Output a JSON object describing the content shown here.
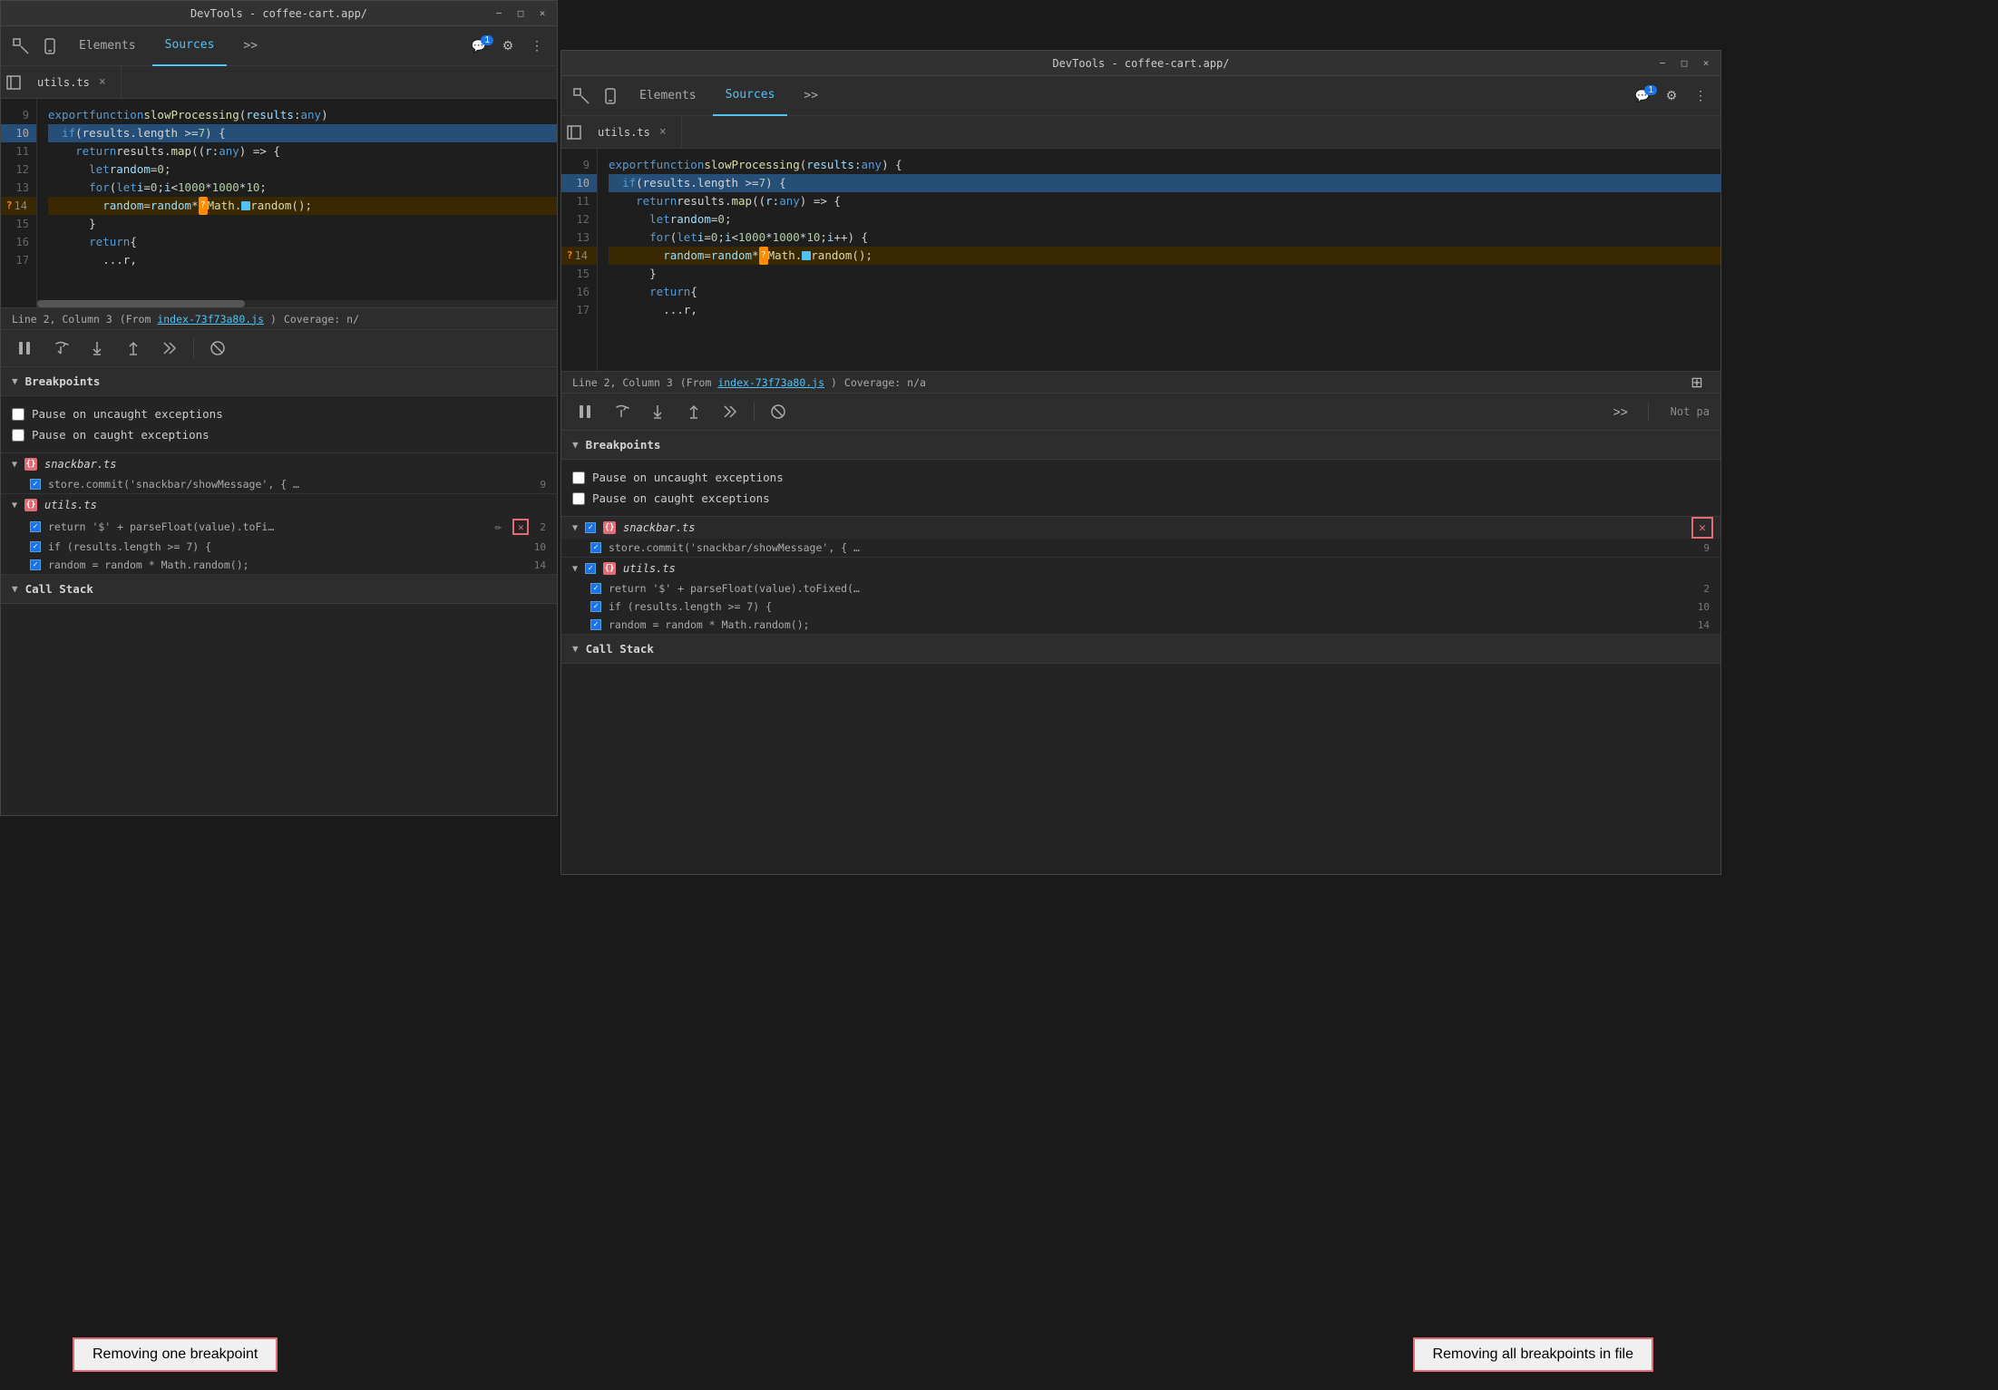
{
  "windows": {
    "left": {
      "title": "DevTools - coffee-cart.app/",
      "tabs": [
        {
          "label": "Elements",
          "active": false
        },
        {
          "label": "Sources",
          "active": true
        },
        {
          "label": ">>",
          "active": false
        }
      ],
      "badge": "1",
      "file_tab": "utils.ts",
      "code": {
        "lines": [
          {
            "num": 9,
            "content": "export function slowProcessing(results: any)",
            "type": "normal"
          },
          {
            "num": 10,
            "content": "  if (results.length >= 7) {",
            "type": "highlighted"
          },
          {
            "num": 11,
            "content": "    return results.map((r: any) => {",
            "type": "normal"
          },
          {
            "num": 12,
            "content": "      let random = 0;",
            "type": "normal"
          },
          {
            "num": 13,
            "content": "      for (let i = 0; i < 1000 * 1000 * 10;",
            "type": "normal"
          },
          {
            "num": 14,
            "content": "        random = random * Math.random();",
            "type": "question"
          },
          {
            "num": 15,
            "content": "      }",
            "type": "normal"
          },
          {
            "num": 16,
            "content": "      return {",
            "type": "normal"
          },
          {
            "num": 17,
            "content": "        ...r,",
            "type": "normal"
          }
        ]
      },
      "status_bar": {
        "position": "Line 2, Column 3",
        "source": "(From index-73f73a80.js)",
        "source_link": "index-73f73a80.js",
        "coverage": "Coverage: n/"
      },
      "breakpoints": {
        "title": "Breakpoints",
        "pause_uncaught": "Pause on uncaught exceptions",
        "pause_caught": "Pause on caught exceptions",
        "files": [
          {
            "name": "snackbar.ts",
            "items": [
              {
                "code": "store.commit('snackbar/showMessage', { …",
                "line": 9
              }
            ]
          },
          {
            "name": "utils.ts",
            "items": [
              {
                "code": "return '$' + parseFloat(value).toFi…",
                "line": 2,
                "has_remove_one": true
              },
              {
                "code": "if (results.length >= 7) {",
                "line": 10
              },
              {
                "code": "random = random * Math.random();",
                "line": 14
              }
            ]
          }
        ]
      },
      "call_stack": {
        "title": "Call Stack"
      }
    },
    "right": {
      "title": "DevTools - coffee-cart.app/",
      "tabs": [
        {
          "label": "Elements",
          "active": false
        },
        {
          "label": "Sources",
          "active": true
        },
        {
          "label": ">>",
          "active": false
        }
      ],
      "badge": "1",
      "file_tab": "utils.ts",
      "code": {
        "lines": [
          {
            "num": 9,
            "content": "export function slowProcessing(results: any) {",
            "type": "normal"
          },
          {
            "num": 10,
            "content": "  if (results.length >= 7) {",
            "type": "highlighted"
          },
          {
            "num": 11,
            "content": "    return results.map((r: any) => {",
            "type": "normal"
          },
          {
            "num": 12,
            "content": "      let random = 0;",
            "type": "normal"
          },
          {
            "num": 13,
            "content": "      for (let i = 0; i < 1000 * 1000 * 10; i++) {",
            "type": "normal"
          },
          {
            "num": 14,
            "content": "        random = random * Math.random();",
            "type": "question"
          },
          {
            "num": 15,
            "content": "      }",
            "type": "normal"
          },
          {
            "num": 16,
            "content": "      return {",
            "type": "normal"
          },
          {
            "num": 17,
            "content": "        ...r,",
            "type": "normal"
          }
        ]
      },
      "status_bar": {
        "position": "Line 2, Column 3",
        "source": "(From index-73f73a80.js)",
        "source_link": "index-73f73a80.js",
        "coverage": "Coverage: n/a"
      },
      "breakpoints": {
        "title": "Breakpoints",
        "pause_uncaught": "Pause on uncaught exceptions",
        "pause_caught": "Pause on caught exceptions",
        "files": [
          {
            "name": "snackbar.ts",
            "items": [
              {
                "code": "store.commit('snackbar/showMessage', { …",
                "line": 9
              }
            ],
            "has_remove_all": true
          },
          {
            "name": "utils.ts",
            "items": [
              {
                "code": "return '$' + parseFloat(value).toFixed(…",
                "line": 2
              },
              {
                "code": "if (results.length >= 7) {",
                "line": 10
              },
              {
                "code": "random = random * Math.random();",
                "line": 14
              }
            ]
          }
        ]
      },
      "call_stack": {
        "title": "Call Stack"
      },
      "not_paused": "Not pa"
    }
  },
  "annotations": {
    "left": "Removing one breakpoint",
    "right": "Removing all breakpoints in file"
  },
  "icons": {
    "pause": "⏸",
    "step_over": "↷",
    "step_into": "↓",
    "step_out": "↑",
    "continue": "→",
    "deactivate": "⊘",
    "chevron_right": "▶",
    "chevron_down": "▼",
    "close": "×",
    "gear": "⚙",
    "more": "⋮",
    "minimize": "−",
    "maximize": "□",
    "x_close": "×",
    "sidebar": "⊟",
    "inspect": "⬚",
    "device": "□"
  }
}
